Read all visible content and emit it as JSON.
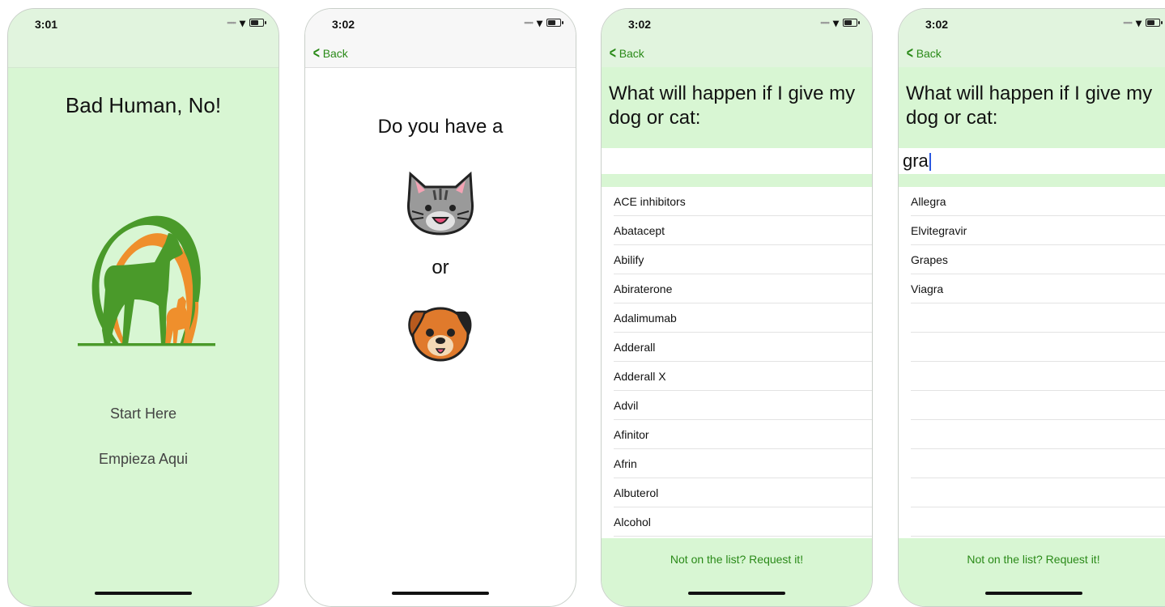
{
  "screens": [
    {
      "time": "3:01",
      "title": "Bad Human, No!",
      "start_en": "Start Here",
      "start_es": "Empieza Aqui"
    },
    {
      "time": "3:02",
      "back": "Back",
      "prompt": "Do you have a",
      "or": "or"
    },
    {
      "time": "3:02",
      "back": "Back",
      "question": "What will happen if I give my dog or cat:",
      "search_value": "",
      "drugs": [
        "ACE inhibitors",
        "Abatacept",
        "Abilify",
        "Abiraterone",
        "Adalimumab",
        "Adderall",
        "Adderall X",
        "Advil",
        "Afinitor",
        "Afrin",
        "Albuterol",
        "Alcohol"
      ],
      "footer": "Not on the list? Request it!"
    },
    {
      "time": "3:02",
      "back": "Back",
      "question": "What will happen if I give my dog or cat:",
      "search_value": "gra",
      "drugs": [
        "Allegra",
        "Elvitegravir",
        "Grapes",
        "Viagra"
      ],
      "footer": "Not on the list? Request it!"
    }
  ],
  "colors": {
    "accent_green": "#2a8a18",
    "panel_green": "#d8f6d3",
    "bar_green": "#e1f4de",
    "logo_dark_green": "#4a9a2a",
    "logo_orange": "#ef8f2c",
    "text_cursor": "#2b58e0"
  }
}
